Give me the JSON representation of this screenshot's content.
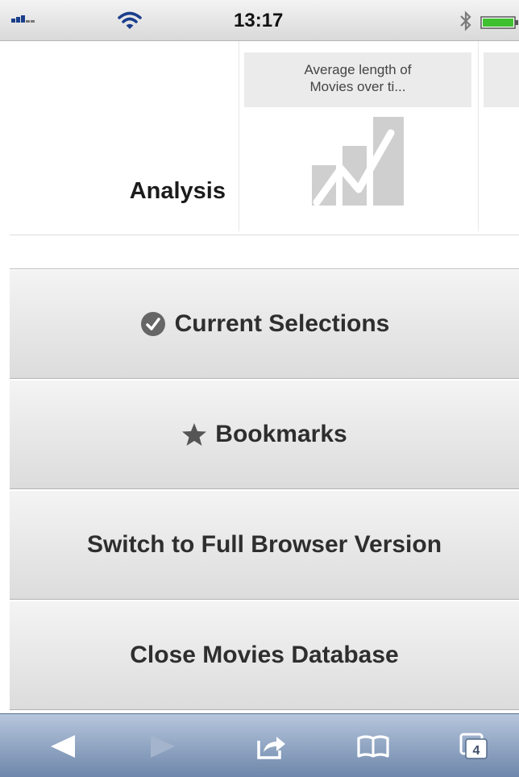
{
  "status_bar": {
    "time": "13:17",
    "icons": [
      "signal-icon",
      "wifi-icon",
      "bluetooth-icon",
      "battery-icon"
    ]
  },
  "analysis": {
    "label": "Analysis",
    "sheets": [
      {
        "title_line1": "Average length of",
        "title_line2": "Movies over ti...",
        "icon": "line-chart-icon"
      }
    ]
  },
  "menu": {
    "items": [
      {
        "label": "Current Selections",
        "icon": "check-circle-icon"
      },
      {
        "label": "Bookmarks",
        "icon": "star-icon"
      },
      {
        "label": "Switch to Full Browser Version"
      },
      {
        "label": "Close Movies Database"
      }
    ]
  },
  "toolbar": {
    "tabs_count": "4",
    "icons": [
      "back-arrow-icon",
      "forward-arrow-icon",
      "share-icon",
      "bookmarks-book-icon",
      "tabs-icon"
    ]
  },
  "colors": {
    "toolbar_top": "#b6c6dc",
    "toolbar_bottom": "#6e87ab",
    "button_top": "#f4f4f4",
    "button_bottom": "#dcdcdc",
    "chart_icon": "#cfcfcf",
    "signal_bar": "#1a3e8c",
    "battery_fill": "#3fc02f"
  }
}
